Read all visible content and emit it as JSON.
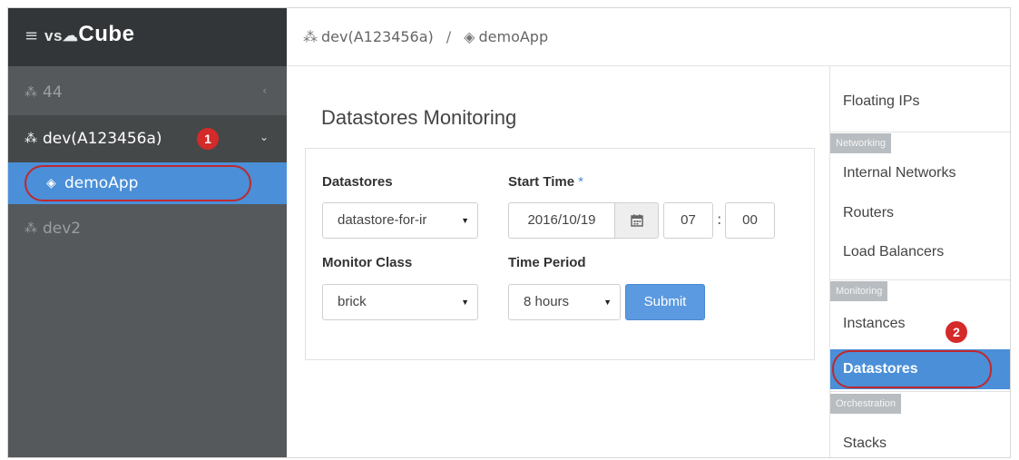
{
  "app": {
    "menu_icon": "hamburger-icon",
    "brand_prefix": "vs",
    "brand_name": "Cube"
  },
  "sidebar": {
    "projects": [
      {
        "label": "44",
        "icon": "cubes-icon",
        "collapsed_icon": "chevron-left-icon"
      },
      {
        "label": "dev(A123456a)",
        "icon": "cubes-icon",
        "expanded_icon": "chevron-down-icon",
        "annotation": "1"
      },
      {
        "label": "demoApp",
        "icon": "cube-icon",
        "selected": true
      },
      {
        "label": "dev2",
        "icon": "cubes-icon"
      }
    ]
  },
  "header": {
    "breadcrumb": [
      {
        "label": "dev(A123456a)",
        "icon": "cubes-icon"
      },
      {
        "label": "demoApp",
        "icon": "cube-icon"
      }
    ],
    "separator": "/"
  },
  "main": {
    "title": "Datastores Monitoring",
    "form": {
      "datastores_label": "Datastores",
      "datastores_value": "datastore-for-ir",
      "start_time_label": "Start Time",
      "required_mark": "*",
      "start_date": "2016/10/19",
      "start_hour": "07",
      "start_minute": "00",
      "time_separator": ":",
      "monitor_class_label": "Monitor Class",
      "monitor_class_value": "brick",
      "time_period_label": "Time Period",
      "time_period_value": "8 hours",
      "submit_label": "Submit"
    }
  },
  "right_nav": {
    "items": {
      "floating_ips": "Floating IPs",
      "internal_networks": "Internal Networks",
      "routers": "Routers",
      "load_balancers": "Load Balancers",
      "instances": "Instances",
      "datastores": "Datastores",
      "stacks": "Stacks"
    },
    "categories": {
      "networking": "Networking",
      "monitoring": "Monitoring",
      "orchestration": "Orchestration"
    },
    "active_item": "Datastores",
    "annotation": "2"
  },
  "colors": {
    "sidebar_bg": "#55595c",
    "brand_bar_bg": "#333638",
    "accent_blue": "#4a8fd8",
    "annotation_red": "#d42a2a"
  }
}
